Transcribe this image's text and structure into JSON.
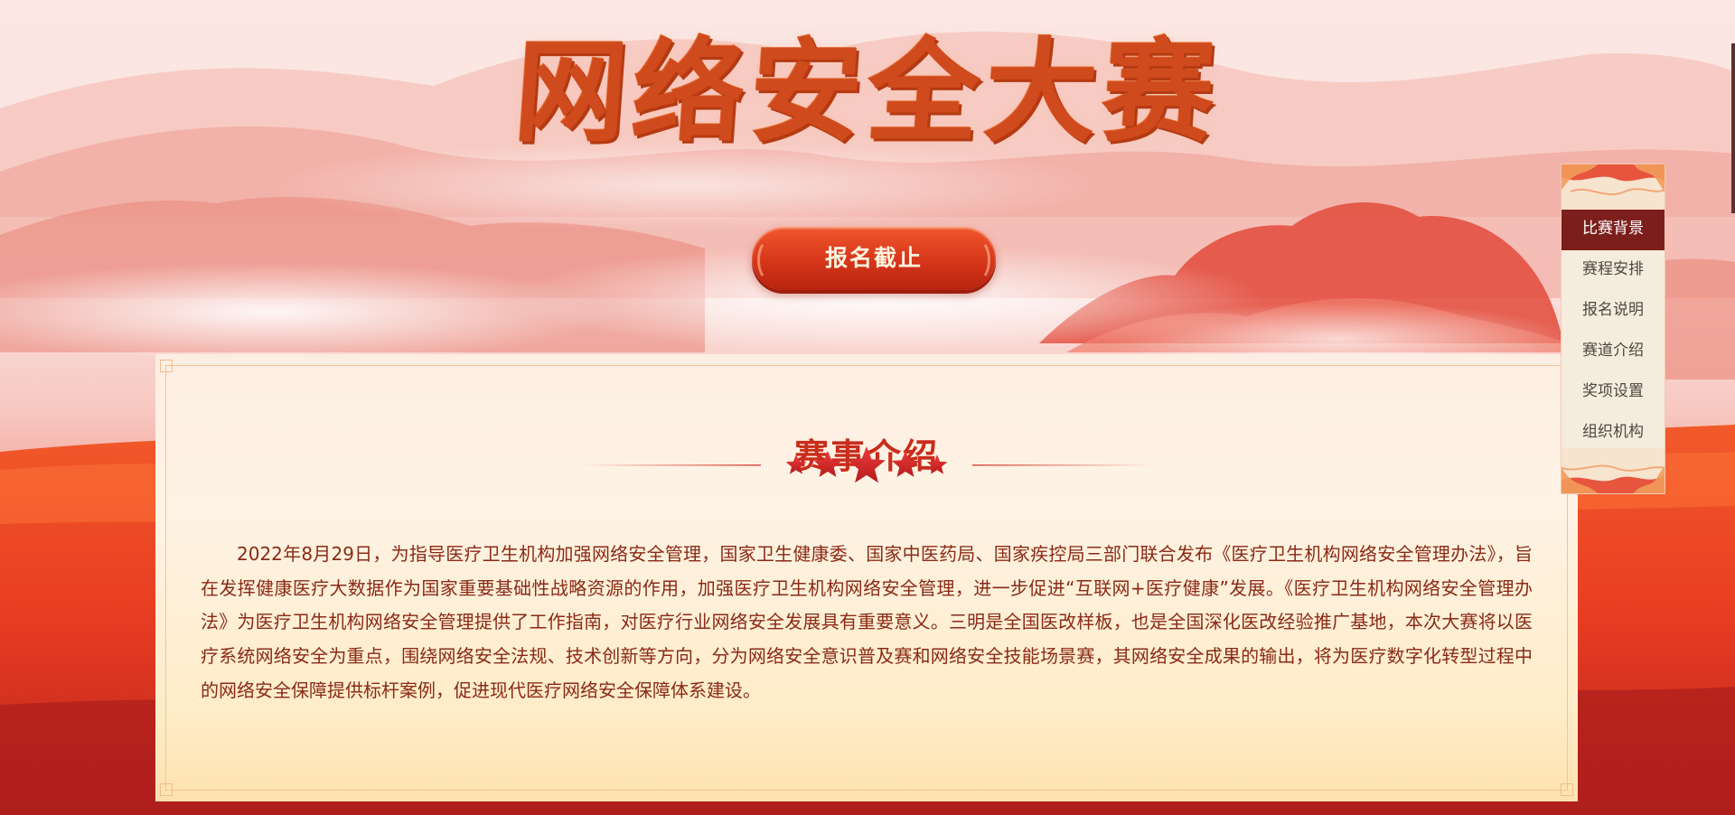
{
  "hero": {
    "title": "网络安全大赛",
    "signup_button_label": "报名截止"
  },
  "intro": {
    "title": "赛事介绍",
    "paragraph": "2022年8月29日，为指导医疗卫生机构加强网络安全管理，国家卫生健康委、国家中医药局、国家疾控局三部门联合发布《医疗卫生机构网络安全管理办法》，旨在发挥健康医疗大数据作为国家重要基础性战略资源的作用，加强医疗卫生机构网络安全管理，进一步促进“互联网+医疗健康”发展。《医疗卫生机构网络安全管理办法》为医疗卫生机构网络安全管理提供了工作指南，对医疗行业网络安全发展具有重要意义。三明是全国医改样板，也是全国深化医改经验推广基地，本次大赛将以医疗系统网络安全为重点，围绕网络安全法规、技术创新等方向，分为网络安全意识普及赛和网络安全技能场景赛，其网络安全成果的输出，将为医疗数字化转型过程中的网络安全保障提供标杆案例，促进现代医疗网络安全保障体系建设。",
    "divider_icons": [
      "star-icon",
      "star-icon",
      "star-icon",
      "star-icon",
      "star-icon"
    ]
  },
  "side_nav": {
    "active_index": 0,
    "items": [
      {
        "label": "比赛背景"
      },
      {
        "label": "赛程安排"
      },
      {
        "label": "报名说明"
      },
      {
        "label": "赛道介绍"
      },
      {
        "label": "奖项设置"
      },
      {
        "label": "组织机构"
      }
    ]
  },
  "colors": {
    "title_red": "#cf4a1c",
    "button_red": "#d6361a",
    "intro_title": "#c92d1c",
    "body_text": "#8a2a16",
    "nav_active_bg": "#7c1f1c",
    "panel_bg": "#fef3e4"
  }
}
